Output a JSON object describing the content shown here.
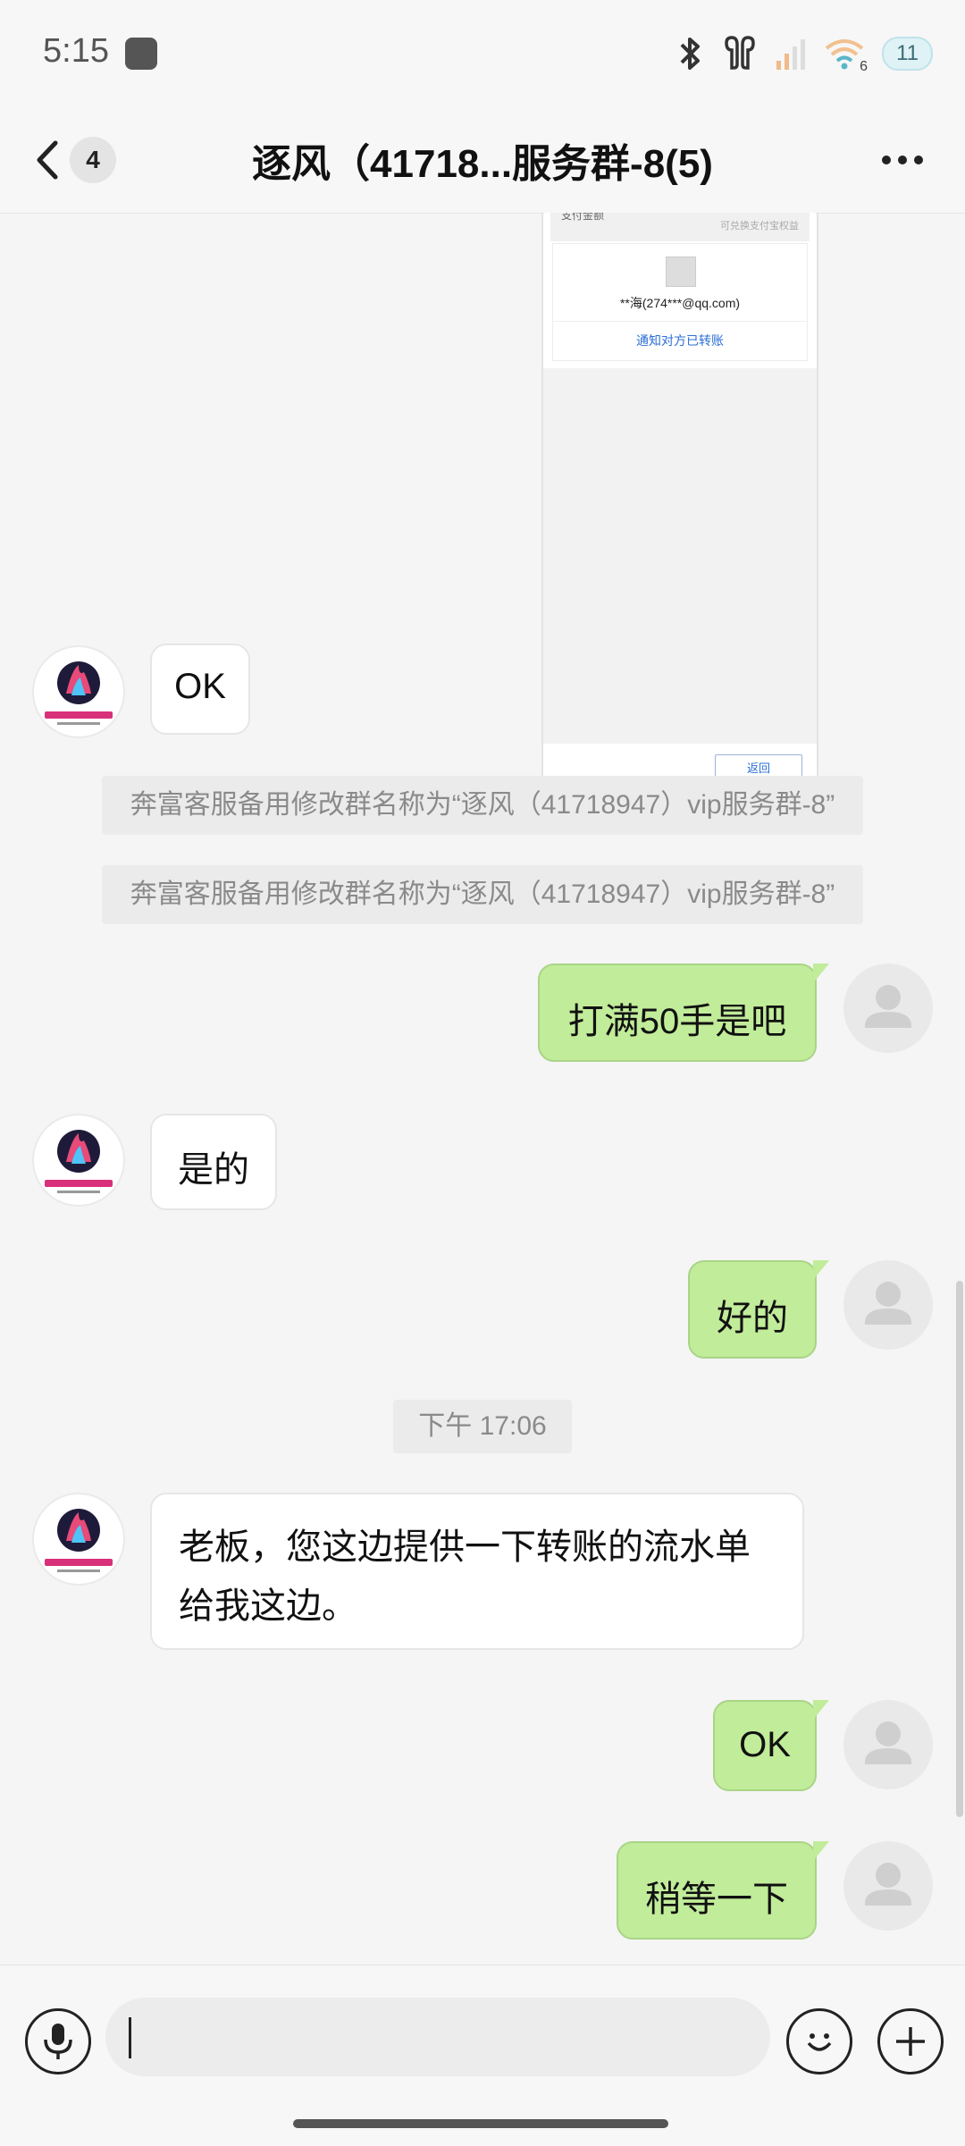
{
  "status_bar": {
    "time": "5:15",
    "network_label": "6",
    "battery": "11"
  },
  "header": {
    "back_count": "4",
    "title": "逐风（41718...服务群-8(5)"
  },
  "screenshot": {
    "top_left": "支付金额",
    "top_right": "可兑换支付宝权益",
    "email": "**海(274***@qq.com)",
    "link": "通知对方已转账",
    "return_btn": "返回"
  },
  "messages": {
    "m1": "OK",
    "sys1": "奔富客服备用修改群名称为“逐风（41718947）vip服务群-8”",
    "sys2": "奔富客服备用修改群名称为“逐风（41718947）vip服务群-8”",
    "m2": "打满50手是吧",
    "m3": "是的",
    "m4": "好的",
    "time_sep": "下午 17:06",
    "m5": "老板，您这边提供一下转账的流水单给我这边。",
    "m6": "OK",
    "m7": "稍等一下"
  },
  "input": {
    "placeholder": "",
    "value": ""
  },
  "colors": {
    "out_bubble": "#c1ec9a",
    "in_bubble": "#ffffff",
    "background": "#f5f5f5"
  }
}
